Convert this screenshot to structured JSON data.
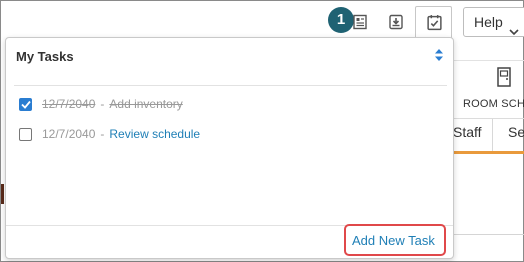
{
  "toolbar": {
    "notification_count": "1",
    "icons": [
      "notes-icon",
      "inbox-download-icon",
      "tasks-calendar-icon"
    ],
    "help_label": "Help"
  },
  "background": {
    "room_label": "ROOM SCH",
    "tabs": [
      "Staff",
      "Se"
    ],
    "accent_color": "#e99a3c"
  },
  "tasks_panel": {
    "title": "My Tasks",
    "separator": "-",
    "tasks": [
      {
        "date": "12/7/2040",
        "name": "Add inventory",
        "completed": true
      },
      {
        "date": "12/7/2040",
        "name": "Review schedule",
        "completed": false
      }
    ],
    "add_task_label": "Add New Task"
  },
  "colors": {
    "badge": "#1f6273",
    "link": "#1f7fb6",
    "highlight": "#e0484a",
    "checkbox": "#2a7dd1"
  }
}
